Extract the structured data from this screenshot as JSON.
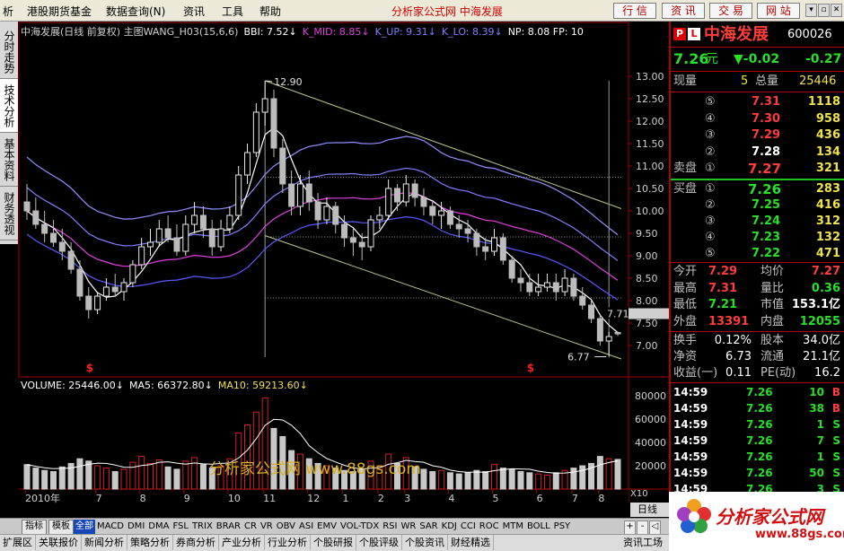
{
  "menu": {
    "items": [
      "析",
      "港股期货基金",
      "数据查询(N)",
      "资讯",
      "工具",
      "帮助"
    ],
    "center_title": "分析家公式网  中海发展",
    "right_buttons": [
      "行 信",
      "资 讯",
      "交 易",
      "网 站"
    ],
    "window_controls": [
      "▾",
      "▫",
      "✕"
    ]
  },
  "left_tabs": [
    "分时走势",
    "技术分析",
    "基本资料",
    "财务透视"
  ],
  "chart_header": [
    {
      "text": "中海发展(日线 前复权) 主图WANG_H03(15,6,6)",
      "color": "#d0d0d0"
    },
    {
      "text": "BBI: 7.52↓",
      "color": "#ffffff"
    },
    {
      "text": "K_MID: 8.85↓",
      "color": "#e040e0"
    },
    {
      "text": "K_UP: 9.31↓",
      "color": "#8080ff"
    },
    {
      "text": "K_LO: 8.39↓",
      "color": "#8080ff"
    },
    {
      "text": "NP: 8.08  FP: 10",
      "color": "#ffffff"
    }
  ],
  "volume_header": [
    {
      "text": "VOLUME: 25446.00↓",
      "color": "#ffffff"
    },
    {
      "text": "MA5: 66372.80↓",
      "color": "#ffffff"
    },
    {
      "text": "MA10: 59213.60↓",
      "color": "#f0e24a"
    }
  ],
  "chart_data": {
    "type": "bar",
    "title": "中海发展(日线 前复权)",
    "price_ticks": [
      "13.00",
      "12.50",
      "12.00",
      "11.50",
      "11.00",
      "10.50",
      "10.00",
      "9.50",
      "9.00",
      "8.50",
      "8.00",
      "7.50",
      "7.00"
    ],
    "volume_ticks": [
      "80000",
      "60000",
      "40000",
      "20000"
    ],
    "volume_multiplier_label": "X10",
    "period_label": "日线",
    "annotations": [
      {
        "index": 27,
        "price": 12.9,
        "text": "12.90"
      },
      {
        "index": 66,
        "price": 6.77,
        "text": "6.77"
      },
      {
        "index": 67,
        "price": 7.71,
        "text": "7.71"
      }
    ],
    "signal_marks": [
      {
        "index": 7,
        "text": "$"
      },
      {
        "index": 57,
        "text": "$"
      }
    ],
    "month_labels": [
      {
        "index": 0,
        "label": "2010年"
      },
      {
        "index": 8,
        "label": "7"
      },
      {
        "index": 13,
        "label": "8"
      },
      {
        "index": 18,
        "label": "9"
      },
      {
        "index": 23,
        "label": "10"
      },
      {
        "index": 27,
        "label": "11"
      },
      {
        "index": 32,
        "label": "12"
      },
      {
        "index": 36,
        "label": "1"
      },
      {
        "index": 40,
        "label": "2"
      },
      {
        "index": 43,
        "label": "3"
      },
      {
        "index": 48,
        "label": "4"
      },
      {
        "index": 53,
        "label": "5"
      },
      {
        "index": 58,
        "label": "6"
      },
      {
        "index": 62,
        "label": "7"
      },
      {
        "index": 65,
        "label": "8"
      }
    ],
    "candles": {
      "columns": [
        "open",
        "high",
        "low",
        "close",
        "volume"
      ],
      "rows": [
        [
          10.2,
          10.6,
          9.8,
          10.0,
          21000
        ],
        [
          10.0,
          10.3,
          9.6,
          9.7,
          18000
        ],
        [
          9.7,
          10.0,
          9.3,
          9.5,
          16000
        ],
        [
          9.5,
          9.8,
          9.2,
          9.3,
          15000
        ],
        [
          9.3,
          9.6,
          8.9,
          9.1,
          19000
        ],
        [
          9.1,
          9.3,
          8.6,
          8.7,
          22000
        ],
        [
          8.7,
          8.9,
          8.0,
          8.1,
          26000
        ],
        [
          8.1,
          8.3,
          7.6,
          7.8,
          24000
        ],
        [
          7.8,
          8.2,
          7.7,
          8.1,
          20000
        ],
        [
          8.1,
          8.5,
          8.0,
          8.3,
          18000
        ],
        [
          8.3,
          8.6,
          8.1,
          8.2,
          15000
        ],
        [
          8.2,
          8.5,
          8.0,
          8.4,
          17000
        ],
        [
          8.4,
          8.9,
          8.3,
          8.8,
          23000
        ],
        [
          8.8,
          9.4,
          8.7,
          9.2,
          28000
        ],
        [
          9.2,
          9.6,
          9.0,
          9.3,
          22000
        ],
        [
          9.3,
          9.8,
          9.2,
          9.6,
          25000
        ],
        [
          9.6,
          9.9,
          9.3,
          9.4,
          19000
        ],
        [
          9.4,
          9.7,
          9.0,
          9.1,
          17000
        ],
        [
          9.1,
          9.9,
          9.0,
          9.7,
          24000
        ],
        [
          9.7,
          10.2,
          9.5,
          9.9,
          27000
        ],
        [
          9.9,
          10.1,
          9.4,
          9.6,
          21000
        ],
        [
          9.6,
          9.8,
          9.0,
          9.2,
          18000
        ],
        [
          9.2,
          9.8,
          9.1,
          9.6,
          20000
        ],
        [
          9.6,
          10.1,
          9.5,
          9.9,
          26000
        ],
        [
          9.9,
          11.0,
          9.8,
          10.8,
          48000
        ],
        [
          10.8,
          11.5,
          10.6,
          11.3,
          55000
        ],
        [
          11.3,
          12.4,
          11.2,
          12.2,
          66000
        ],
        [
          12.2,
          12.9,
          11.9,
          12.5,
          78000
        ],
        [
          12.5,
          12.7,
          11.2,
          11.4,
          52000
        ],
        [
          11.4,
          11.6,
          10.4,
          10.6,
          45000
        ],
        [
          10.6,
          10.9,
          9.9,
          10.1,
          33000
        ],
        [
          10.1,
          10.8,
          9.9,
          10.6,
          30000
        ],
        [
          10.6,
          10.9,
          10.0,
          10.2,
          26000
        ],
        [
          10.2,
          10.4,
          9.6,
          9.8,
          22000
        ],
        [
          9.8,
          10.3,
          9.7,
          10.1,
          20000
        ],
        [
          10.1,
          10.2,
          9.5,
          9.7,
          18000
        ],
        [
          9.7,
          9.9,
          9.2,
          9.4,
          16000
        ],
        [
          9.4,
          9.6,
          9.0,
          9.3,
          15000
        ],
        [
          9.3,
          9.5,
          8.9,
          9.2,
          17000
        ],
        [
          9.2,
          9.9,
          9.1,
          9.8,
          24000
        ],
        [
          9.8,
          10.1,
          9.6,
          9.9,
          20000
        ],
        [
          9.9,
          10.7,
          9.8,
          10.5,
          30000
        ],
        [
          10.5,
          10.6,
          10.0,
          10.2,
          22000
        ],
        [
          10.2,
          10.8,
          10.1,
          10.6,
          27000
        ],
        [
          10.6,
          10.7,
          10.1,
          10.3,
          19000
        ],
        [
          10.3,
          10.5,
          9.9,
          10.1,
          17000
        ],
        [
          10.1,
          10.2,
          9.7,
          9.9,
          15000
        ],
        [
          9.9,
          10.2,
          9.6,
          10.0,
          16000
        ],
        [
          10.0,
          10.1,
          9.6,
          9.7,
          14000
        ],
        [
          9.7,
          9.9,
          9.4,
          9.6,
          13000
        ],
        [
          9.6,
          9.8,
          9.3,
          9.5,
          14000
        ],
        [
          9.5,
          9.6,
          9.0,
          9.2,
          16000
        ],
        [
          9.2,
          9.4,
          8.9,
          9.1,
          15000
        ],
        [
          9.1,
          9.6,
          9.0,
          9.4,
          21000
        ],
        [
          9.4,
          9.5,
          8.8,
          8.9,
          18000
        ],
        [
          8.9,
          9.0,
          8.4,
          8.5,
          17000
        ],
        [
          8.5,
          8.7,
          8.2,
          8.4,
          15000
        ],
        [
          8.4,
          8.6,
          8.1,
          8.2,
          14000
        ],
        [
          8.2,
          8.6,
          8.1,
          8.3,
          13000
        ],
        [
          8.3,
          8.6,
          8.2,
          8.4,
          12000
        ],
        [
          8.4,
          8.6,
          8.0,
          8.2,
          14000
        ],
        [
          8.2,
          8.7,
          8.1,
          8.5,
          16000
        ],
        [
          8.5,
          8.6,
          8.0,
          8.1,
          18000
        ],
        [
          8.1,
          8.3,
          7.8,
          7.9,
          20000
        ],
        [
          7.9,
          8.0,
          7.5,
          7.6,
          22000
        ],
        [
          7.6,
          7.71,
          7.0,
          7.1,
          28000
        ],
        [
          7.1,
          7.3,
          6.77,
          7.2,
          26000
        ],
        [
          7.29,
          7.31,
          7.21,
          7.26,
          25446
        ]
      ]
    },
    "colors": {
      "up": "#e8e8e8",
      "down": "#bcbcbc",
      "vol_up": "#d02020",
      "vol_down": "#c8c8c8",
      "bbi": "#ffffff",
      "k_mid": "#e040e0",
      "k_up": "#8080ff",
      "k_lo": "#5a5aff",
      "signal": "#ff2020"
    }
  },
  "watermark": "分析家公式网  www.88gs.com",
  "quote": {
    "badges": [
      "P",
      "L"
    ],
    "name": "中海发展",
    "code": "600026",
    "price": "7.26",
    "unit": "元",
    "change": "▼-0.02",
    "pct": "-0.27",
    "xianliang_label": "现量",
    "xianliang": "5",
    "zongliang_label": "总量",
    "zongliang": "25446",
    "sell_label": "卖盘",
    "buy_label": "买盘",
    "sell": [
      {
        "lv": "⑤",
        "price": "7.31",
        "vol": "1118"
      },
      {
        "lv": "④",
        "price": "7.30",
        "vol": "958"
      },
      {
        "lv": "③",
        "price": "7.29",
        "vol": "436"
      },
      {
        "lv": "②",
        "price": "7.28",
        "vol": "134"
      },
      {
        "lv": "①",
        "price": "7.27",
        "vol": "321"
      }
    ],
    "buy": [
      {
        "lv": "①",
        "price": "7.26",
        "vol": "283"
      },
      {
        "lv": "②",
        "price": "7.25",
        "vol": "416"
      },
      {
        "lv": "③",
        "price": "7.24",
        "vol": "312"
      },
      {
        "lv": "④",
        "price": "7.23",
        "vol": "132"
      },
      {
        "lv": "⑤",
        "price": "7.22",
        "vol": "471"
      }
    ],
    "stats": [
      [
        "今开",
        "7.29",
        "均价",
        "7.27"
      ],
      [
        "最高",
        "7.31",
        "量比",
        "0.36"
      ],
      [
        "最低",
        "7.21",
        "市值",
        "153.1亿"
      ],
      [
        "外盘",
        "13391",
        "内盘",
        "12055"
      ]
    ],
    "fin": [
      [
        "换手",
        "0.12%",
        "股本",
        "34.0亿"
      ],
      [
        "净资",
        "6.73",
        "流通",
        "21.1亿"
      ],
      [
        "收益(一)",
        "0.11",
        "PE(动)",
        "16.2"
      ]
    ],
    "ticks": [
      [
        "14:59",
        "7.26",
        "10",
        "B"
      ],
      [
        "14:59",
        "7.26",
        "38",
        "B"
      ],
      [
        "14:59",
        "7.26",
        "1",
        "S"
      ],
      [
        "14:59",
        "7.26",
        "7",
        "S"
      ],
      [
        "14:59",
        "7.26",
        "1",
        "S"
      ],
      [
        "14:59",
        "7.26",
        "50",
        "S"
      ],
      [
        "14:59",
        "7.26",
        "3",
        "S"
      ]
    ]
  },
  "indicator_tabs": {
    "items": [
      "指标",
      "模板",
      "全部",
      "MACD",
      "DMI",
      "DMA",
      "FSL",
      "TRIX",
      "BRAR",
      "CR",
      "VR",
      "OBV",
      "ASI",
      "EMV",
      "VOL-TDX",
      "RSI",
      "WR",
      "SAR",
      "KDJ",
      "CCI",
      "ROC",
      "MTM",
      "BOLL",
      "PSY"
    ],
    "nav": [
      "+",
      "-",
      "◁",
      "▷"
    ]
  },
  "bottom_tabs": {
    "items": [
      "扩展区",
      "关联报价",
      "新闻分析",
      "策略分析",
      "券商分析",
      "产业分析",
      "行业分析",
      "个股研报",
      "个股评级",
      "个股资讯",
      "财经精选"
    ],
    "right": "资讯工场"
  },
  "logo": {
    "name": "分析家公式网",
    "url": "www.88gs.com"
  }
}
